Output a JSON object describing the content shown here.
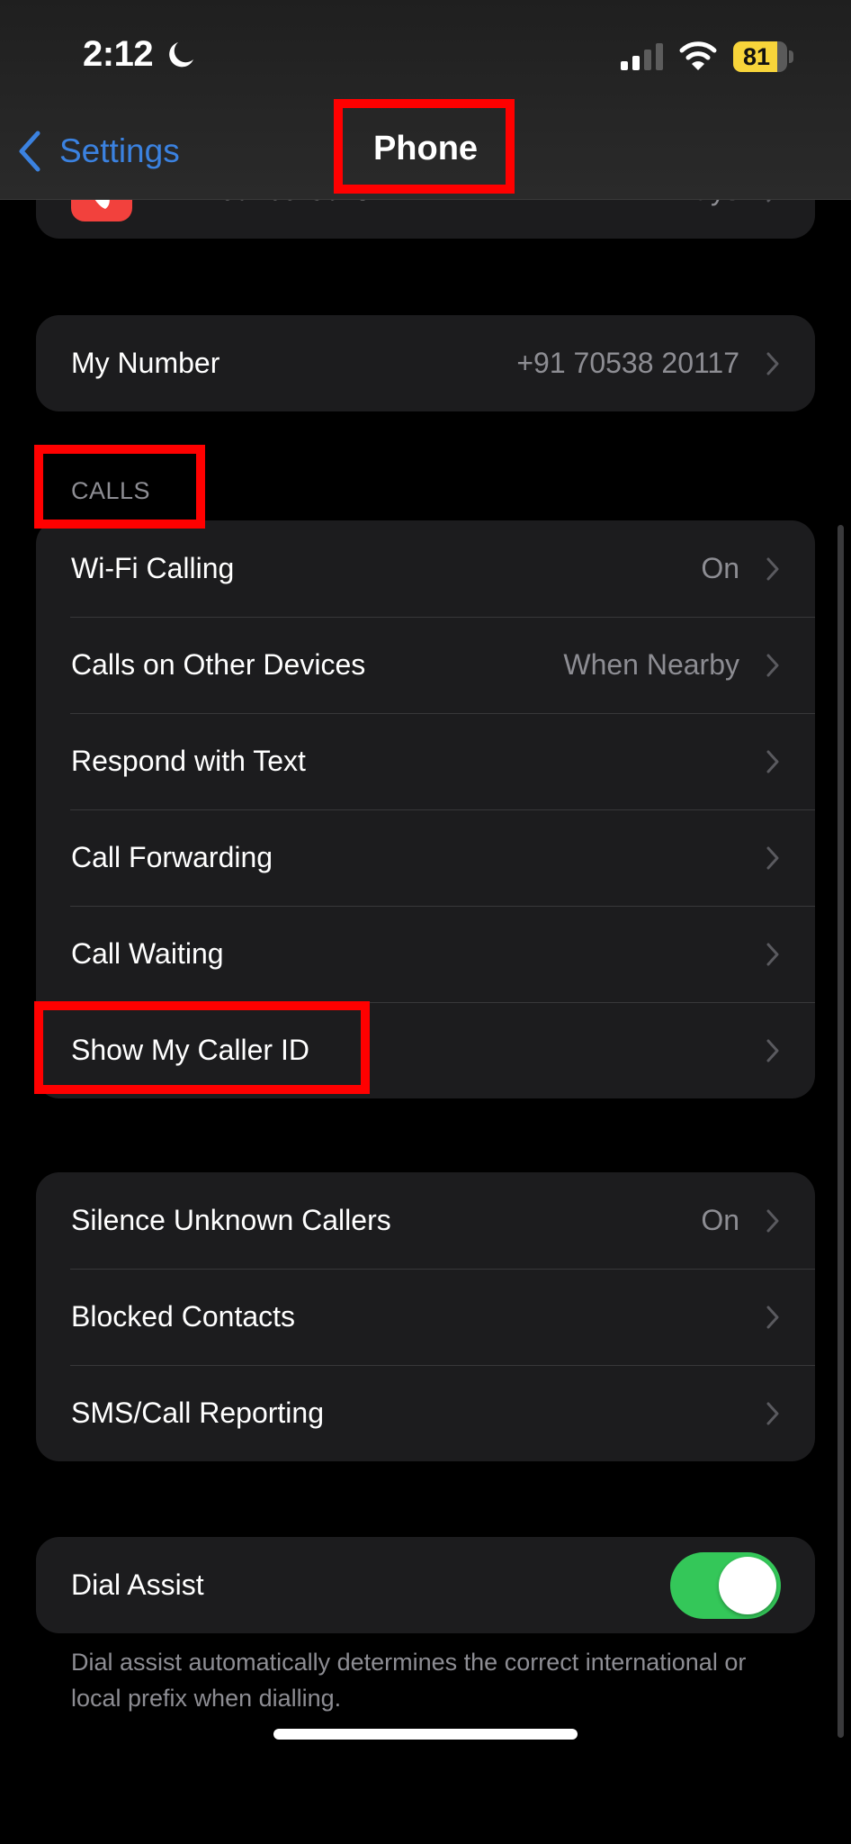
{
  "status_bar": {
    "time": "2:12",
    "focus_icon": "moon-icon",
    "signal_icon": "cellular-signal-icon",
    "signal_bars_active": 2,
    "signal_bars_total": 4,
    "wifi_icon": "wifi-icon",
    "battery_percent": "81",
    "battery_level": 0.81,
    "battery_color": "#f7d43a"
  },
  "nav": {
    "back_label": "Settings",
    "title": "Phone",
    "accent_color": "#3b82e0"
  },
  "partial_row": {
    "label": "Announce Calls",
    "value": "Always",
    "icon": "announce-calls-app-icon"
  },
  "my_number": {
    "label": "My Number",
    "value": "+91 70538 20117"
  },
  "calls_section": {
    "header": "CALLS",
    "rows": [
      {
        "label": "Wi-Fi Calling",
        "value": "On"
      },
      {
        "label": "Calls on Other Devices",
        "value": "When Nearby"
      },
      {
        "label": "Respond with Text",
        "value": ""
      },
      {
        "label": "Call Forwarding",
        "value": ""
      },
      {
        "label": "Call Waiting",
        "value": ""
      },
      {
        "label": "Show My Caller ID",
        "value": ""
      }
    ]
  },
  "blocking_section": {
    "rows": [
      {
        "label": "Silence Unknown Callers",
        "value": "On"
      },
      {
        "label": "Blocked Contacts",
        "value": ""
      },
      {
        "label": "SMS/Call Reporting",
        "value": ""
      }
    ]
  },
  "dial_assist": {
    "label": "Dial Assist",
    "enabled": true,
    "toggle_color": "#34c759",
    "footer": "Dial assist automatically determines the correct international or local prefix when dialling."
  },
  "annotations": {
    "highlight_color": "#ff0000",
    "highlighted": [
      "Phone",
      "CALLS",
      "Show My Caller ID"
    ]
  }
}
